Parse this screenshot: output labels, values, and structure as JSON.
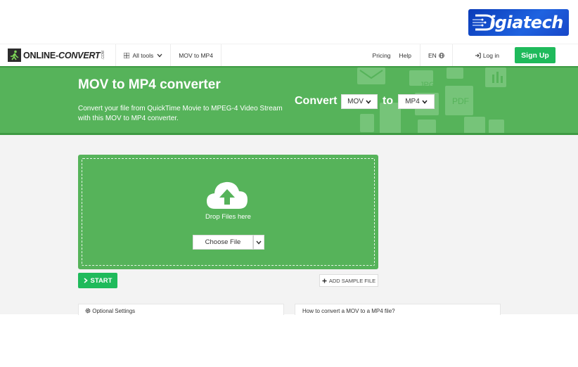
{
  "watermark": {
    "brand": "igiatech"
  },
  "navbar": {
    "logo": {
      "main": "ONLINE-",
      "accent": "CONVERT",
      "suffix": ".COM"
    },
    "all_tools": "All tools",
    "breadcrumb": "MOV to MP4",
    "pricing": "Pricing",
    "help": "Help",
    "language": "EN",
    "login": "Log in",
    "signup": "Sign Up"
  },
  "hero": {
    "title": "MOV to MP4 converter",
    "subtitle": "Convert your file from QuickTime Movie to MPEG-4 Video Stream with this MOV to MP4 converter.",
    "convert_label": "Convert",
    "from_format": "MOV",
    "to_label": "to",
    "to_format": "MP4",
    "deco_labels": [
      "JPG",
      "PDF"
    ]
  },
  "upload": {
    "drop_text": "Drop Files here",
    "choose_label": "Choose File"
  },
  "actions": {
    "start": "START",
    "add_sample": "ADD SAMPLE FILE"
  },
  "panels": {
    "optional_settings": "Optional Settings",
    "how_to": "How to convert a MOV to a MP4 file?"
  },
  "colors": {
    "brand_green": "#56b35a",
    "button_green": "#1fba5b",
    "watermark_blue": "#1747c8"
  }
}
